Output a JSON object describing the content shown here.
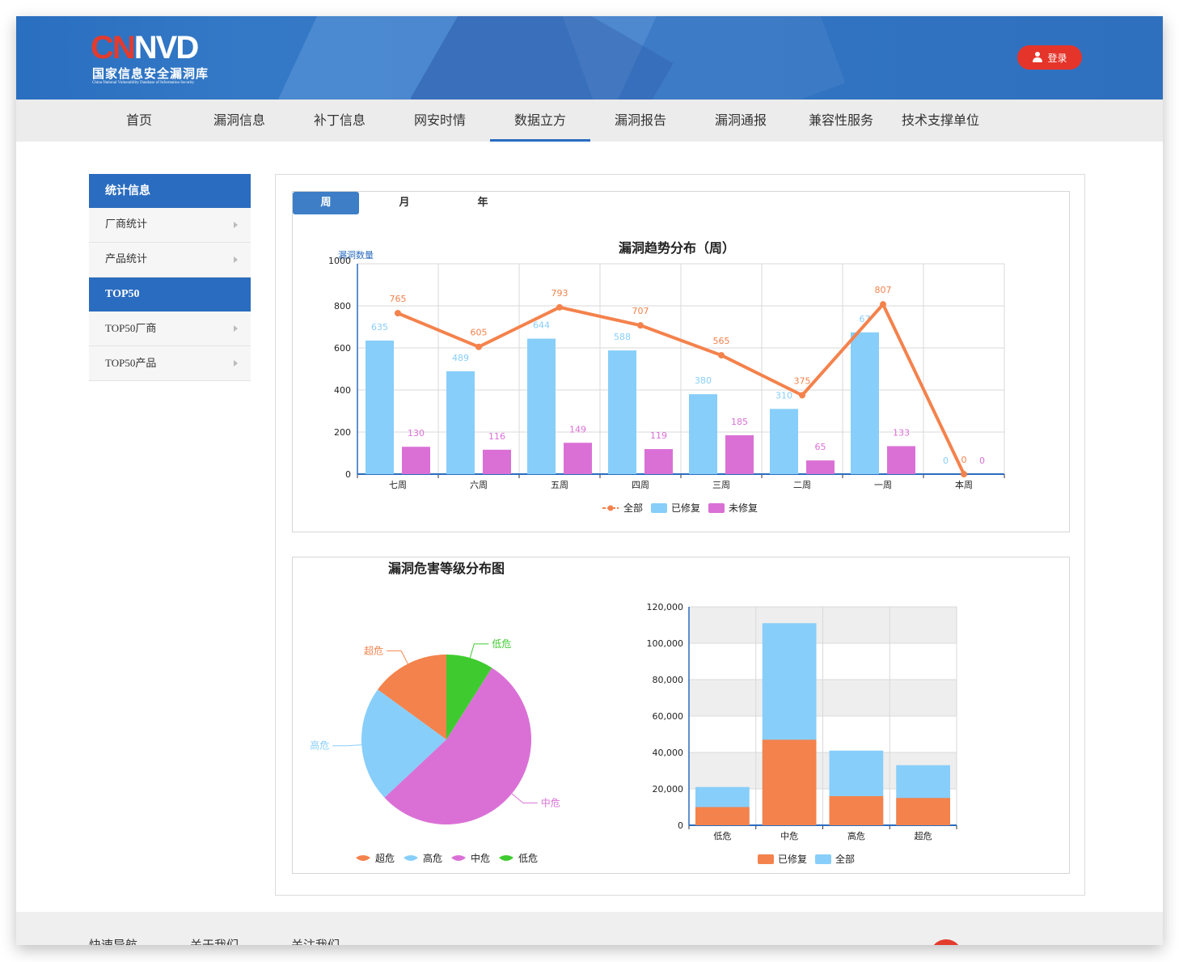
{
  "header": {
    "logo_mark_cn": "CN",
    "logo_mark_nvd": "NVD",
    "logo_cn_name": "国家信息安全漏洞库",
    "logo_en_name": "China National Vulnerability Database of Information Security",
    "login_label": "登录"
  },
  "nav": {
    "items": [
      "首页",
      "漏洞信息",
      "补丁信息",
      "网安时情",
      "数据立方",
      "漏洞报告",
      "漏洞通报",
      "兼容性服务",
      "技术支撑单位"
    ],
    "active_index": 4
  },
  "sidebar": {
    "section1_title": "统计信息",
    "section1_items": [
      "厂商统计",
      "产品统计"
    ],
    "section2_title": "TOP50",
    "section2_items": [
      "TOP50厂商",
      "TOP50产品"
    ]
  },
  "tabs": [
    "周",
    "月",
    "年"
  ],
  "colors": {
    "primary": "#2a6cbf",
    "all_line": "#f4824c",
    "fixed": "#87cefa",
    "unfixed": "#da70d6",
    "critical": "#f4824c",
    "high": "#87cefa",
    "medium": "#da70d6",
    "low": "#3fcb2f"
  },
  "chart_data": [
    {
      "type": "bar",
      "title": "漏洞趋势分布（周）",
      "ylabel": "漏洞数量",
      "categories": [
        "七周",
        "六周",
        "五周",
        "四周",
        "三周",
        "二周",
        "一周",
        "本周"
      ],
      "ylim": [
        0,
        1000
      ],
      "yticks": [
        0,
        200,
        400,
        600,
        800,
        1000
      ],
      "series": [
        {
          "name": "全部",
          "kind": "line",
          "values": [
            765,
            605,
            793,
            707,
            565,
            375,
            807,
            0
          ]
        },
        {
          "name": "已修复",
          "kind": "bar",
          "values": [
            635,
            489,
            644,
            588,
            380,
            310,
            674,
            0
          ]
        },
        {
          "name": "未修复",
          "kind": "bar",
          "values": [
            130,
            116,
            149,
            119,
            185,
            65,
            133,
            0
          ]
        }
      ],
      "value_labels": {
        "全部": [
          "765",
          "605",
          "793",
          "707",
          "565",
          "375",
          "807",
          "0"
        ],
        "已修复": [
          "635",
          "489",
          "644",
          "588",
          "380",
          "310",
          "67",
          "0"
        ],
        "未修复": [
          "130",
          "116",
          "149",
          "119",
          "185",
          "65",
          "133",
          "0"
        ]
      },
      "legend": [
        "全部",
        "已修复",
        "未修复"
      ],
      "legend_position": "bottom",
      "grid": true
    },
    {
      "type": "pie",
      "title": "漏洞危害等级分布图",
      "categories": [
        "超危",
        "高危",
        "中危",
        "低危"
      ],
      "values": [
        15,
        22,
        54,
        9
      ],
      "legend": [
        "超危",
        "高危",
        "中危",
        "低危"
      ],
      "legend_position": "bottom"
    },
    {
      "type": "bar",
      "stacked": true,
      "categories": [
        "低危",
        "中危",
        "高危",
        "超危"
      ],
      "ylim": [
        0,
        120000
      ],
      "yticks": [
        "0",
        "20,000",
        "40,000",
        "60,000",
        "80,000",
        "100,000",
        "120,000"
      ],
      "series": [
        {
          "name": "已修复",
          "values": [
            10000,
            47000,
            16000,
            15000
          ]
        },
        {
          "name": "全部",
          "values": [
            21000,
            111000,
            41000,
            33000
          ]
        }
      ],
      "legend": [
        "已修复",
        "全部"
      ],
      "legend_position": "bottom",
      "grid": true
    }
  ],
  "footer": {
    "links": [
      "快速导航",
      "关于我们",
      "关注我们"
    ]
  }
}
